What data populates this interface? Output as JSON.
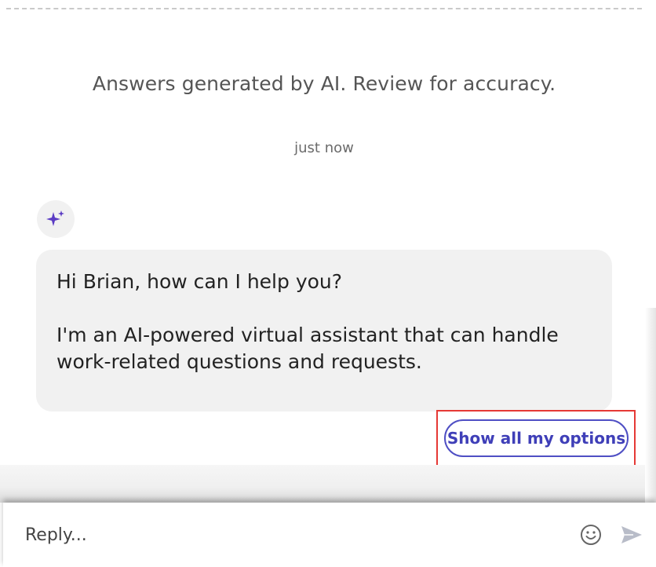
{
  "header": {
    "disclaimer": "Answers generated by AI. Review for accuracy.",
    "timestamp": "just now"
  },
  "message": {
    "avatar_icon": "sparkle-icon",
    "greeting": "Hi Brian, how can I help you?",
    "intro_line1": "I'm an AI-powered virtual assistant that can handle",
    "intro_line2": "work-related questions and requests."
  },
  "actions": {
    "options_label": "Show all my options"
  },
  "composer": {
    "placeholder": "Reply...",
    "emoji_icon": "emoji-icon",
    "send_icon": "send-icon"
  },
  "colors": {
    "accent": "#4f4fc4",
    "highlight": "#e53935",
    "bubble_bg": "#f1f1f1"
  }
}
